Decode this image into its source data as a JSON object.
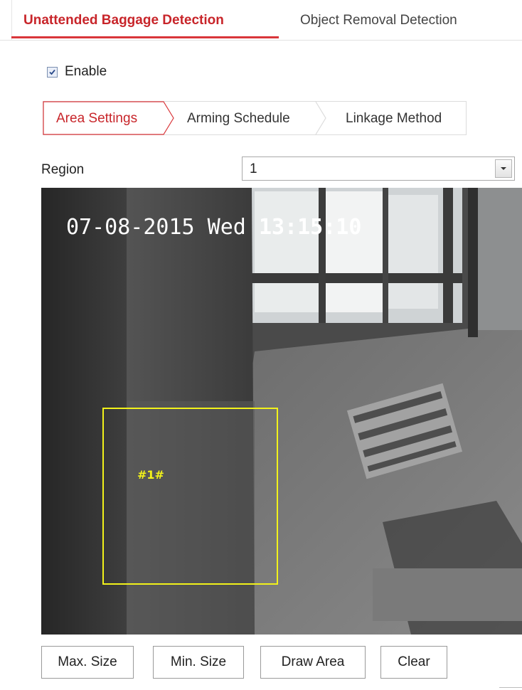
{
  "top_tabs": {
    "active": "Unattended Baggage Detection",
    "inactive": "Object Removal Detection"
  },
  "enable": {
    "label": "Enable",
    "checked": true
  },
  "sub_tabs": {
    "area_settings": "Area Settings",
    "arming_schedule": "Arming Schedule",
    "linkage_method": "Linkage Method"
  },
  "region": {
    "label": "Region",
    "selected": "1"
  },
  "video": {
    "timestamp_date": "07-08-2015 Wed ",
    "timestamp_time": "13:15:10",
    "region_tag": "#1#",
    "region_color": "#f2f21a"
  },
  "buttons": {
    "max_size": "Max. Size",
    "min_size": "Min. Size",
    "draw_area": "Draw Area",
    "clear": "Clear"
  },
  "colors": {
    "accent": "#c8252a"
  }
}
